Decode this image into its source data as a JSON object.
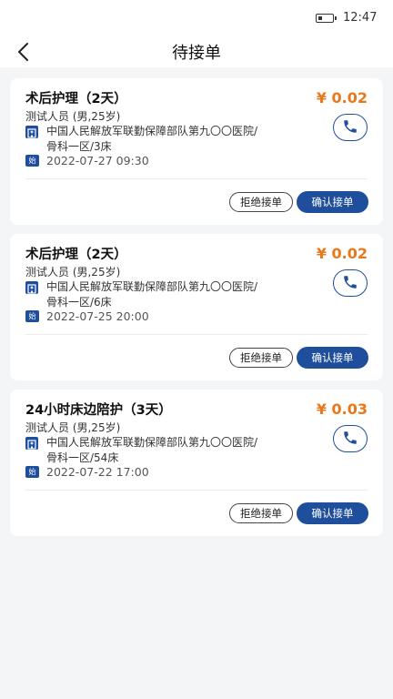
{
  "status_bar": {
    "time": "12:47"
  },
  "nav": {
    "title": "待接单"
  },
  "colors": {
    "accent": "#1f4f9c",
    "price": "#e7781c"
  },
  "orders": [
    {
      "title": "术后护理（2天）",
      "price": "¥ 0.02",
      "patient": "测试人员 (男,25岁)",
      "address_line1": "中国人民解放军联勤保障部队第九〇〇医院/",
      "address_line2": "骨科一区/3床",
      "start_badge": "始",
      "start_time": "2022-07-27 09:30",
      "reject_label": "拒绝接单",
      "accept_label": "确认接单"
    },
    {
      "title": "术后护理（2天）",
      "price": "¥ 0.02",
      "patient": "测试人员 (男,25岁)",
      "address_line1": "中国人民解放军联勤保障部队第九〇〇医院/",
      "address_line2": "骨科一区/6床",
      "start_badge": "始",
      "start_time": "2022-07-25 20:00",
      "reject_label": "拒绝接单",
      "accept_label": "确认接单"
    },
    {
      "title": "24小时床边陪护（3天）",
      "price": "¥ 0.03",
      "patient": "测试人员 (男,25岁)",
      "address_line1": "中国人民解放军联勤保障部队第九〇〇医院/",
      "address_line2": "骨科一区/54床",
      "start_badge": "始",
      "start_time": "2022-07-22 17:00",
      "reject_label": "拒绝接单",
      "accept_label": "确认接单"
    }
  ]
}
